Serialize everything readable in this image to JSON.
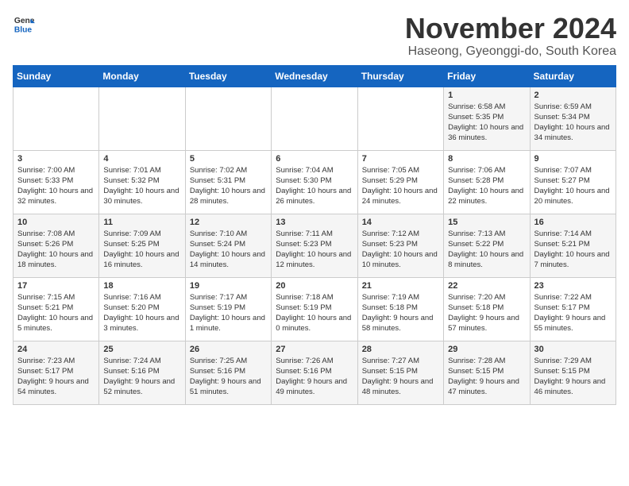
{
  "header": {
    "logo_line1": "General",
    "logo_line2": "Blue",
    "month": "November 2024",
    "location": "Haseong, Gyeonggi-do, South Korea"
  },
  "days_of_week": [
    "Sunday",
    "Monday",
    "Tuesday",
    "Wednesday",
    "Thursday",
    "Friday",
    "Saturday"
  ],
  "weeks": [
    [
      {
        "day": "",
        "info": ""
      },
      {
        "day": "",
        "info": ""
      },
      {
        "day": "",
        "info": ""
      },
      {
        "day": "",
        "info": ""
      },
      {
        "day": "",
        "info": ""
      },
      {
        "day": "1",
        "info": "Sunrise: 6:58 AM\nSunset: 5:35 PM\nDaylight: 10 hours and 36 minutes."
      },
      {
        "day": "2",
        "info": "Sunrise: 6:59 AM\nSunset: 5:34 PM\nDaylight: 10 hours and 34 minutes."
      }
    ],
    [
      {
        "day": "3",
        "info": "Sunrise: 7:00 AM\nSunset: 5:33 PM\nDaylight: 10 hours and 32 minutes."
      },
      {
        "day": "4",
        "info": "Sunrise: 7:01 AM\nSunset: 5:32 PM\nDaylight: 10 hours and 30 minutes."
      },
      {
        "day": "5",
        "info": "Sunrise: 7:02 AM\nSunset: 5:31 PM\nDaylight: 10 hours and 28 minutes."
      },
      {
        "day": "6",
        "info": "Sunrise: 7:04 AM\nSunset: 5:30 PM\nDaylight: 10 hours and 26 minutes."
      },
      {
        "day": "7",
        "info": "Sunrise: 7:05 AM\nSunset: 5:29 PM\nDaylight: 10 hours and 24 minutes."
      },
      {
        "day": "8",
        "info": "Sunrise: 7:06 AM\nSunset: 5:28 PM\nDaylight: 10 hours and 22 minutes."
      },
      {
        "day": "9",
        "info": "Sunrise: 7:07 AM\nSunset: 5:27 PM\nDaylight: 10 hours and 20 minutes."
      }
    ],
    [
      {
        "day": "10",
        "info": "Sunrise: 7:08 AM\nSunset: 5:26 PM\nDaylight: 10 hours and 18 minutes."
      },
      {
        "day": "11",
        "info": "Sunrise: 7:09 AM\nSunset: 5:25 PM\nDaylight: 10 hours and 16 minutes."
      },
      {
        "day": "12",
        "info": "Sunrise: 7:10 AM\nSunset: 5:24 PM\nDaylight: 10 hours and 14 minutes."
      },
      {
        "day": "13",
        "info": "Sunrise: 7:11 AM\nSunset: 5:23 PM\nDaylight: 10 hours and 12 minutes."
      },
      {
        "day": "14",
        "info": "Sunrise: 7:12 AM\nSunset: 5:23 PM\nDaylight: 10 hours and 10 minutes."
      },
      {
        "day": "15",
        "info": "Sunrise: 7:13 AM\nSunset: 5:22 PM\nDaylight: 10 hours and 8 minutes."
      },
      {
        "day": "16",
        "info": "Sunrise: 7:14 AM\nSunset: 5:21 PM\nDaylight: 10 hours and 7 minutes."
      }
    ],
    [
      {
        "day": "17",
        "info": "Sunrise: 7:15 AM\nSunset: 5:21 PM\nDaylight: 10 hours and 5 minutes."
      },
      {
        "day": "18",
        "info": "Sunrise: 7:16 AM\nSunset: 5:20 PM\nDaylight: 10 hours and 3 minutes."
      },
      {
        "day": "19",
        "info": "Sunrise: 7:17 AM\nSunset: 5:19 PM\nDaylight: 10 hours and 1 minute."
      },
      {
        "day": "20",
        "info": "Sunrise: 7:18 AM\nSunset: 5:19 PM\nDaylight: 10 hours and 0 minutes."
      },
      {
        "day": "21",
        "info": "Sunrise: 7:19 AM\nSunset: 5:18 PM\nDaylight: 9 hours and 58 minutes."
      },
      {
        "day": "22",
        "info": "Sunrise: 7:20 AM\nSunset: 5:18 PM\nDaylight: 9 hours and 57 minutes."
      },
      {
        "day": "23",
        "info": "Sunrise: 7:22 AM\nSunset: 5:17 PM\nDaylight: 9 hours and 55 minutes."
      }
    ],
    [
      {
        "day": "24",
        "info": "Sunrise: 7:23 AM\nSunset: 5:17 PM\nDaylight: 9 hours and 54 minutes."
      },
      {
        "day": "25",
        "info": "Sunrise: 7:24 AM\nSunset: 5:16 PM\nDaylight: 9 hours and 52 minutes."
      },
      {
        "day": "26",
        "info": "Sunrise: 7:25 AM\nSunset: 5:16 PM\nDaylight: 9 hours and 51 minutes."
      },
      {
        "day": "27",
        "info": "Sunrise: 7:26 AM\nSunset: 5:16 PM\nDaylight: 9 hours and 49 minutes."
      },
      {
        "day": "28",
        "info": "Sunrise: 7:27 AM\nSunset: 5:15 PM\nDaylight: 9 hours and 48 minutes."
      },
      {
        "day": "29",
        "info": "Sunrise: 7:28 AM\nSunset: 5:15 PM\nDaylight: 9 hours and 47 minutes."
      },
      {
        "day": "30",
        "info": "Sunrise: 7:29 AM\nSunset: 5:15 PM\nDaylight: 9 hours and 46 minutes."
      }
    ]
  ]
}
